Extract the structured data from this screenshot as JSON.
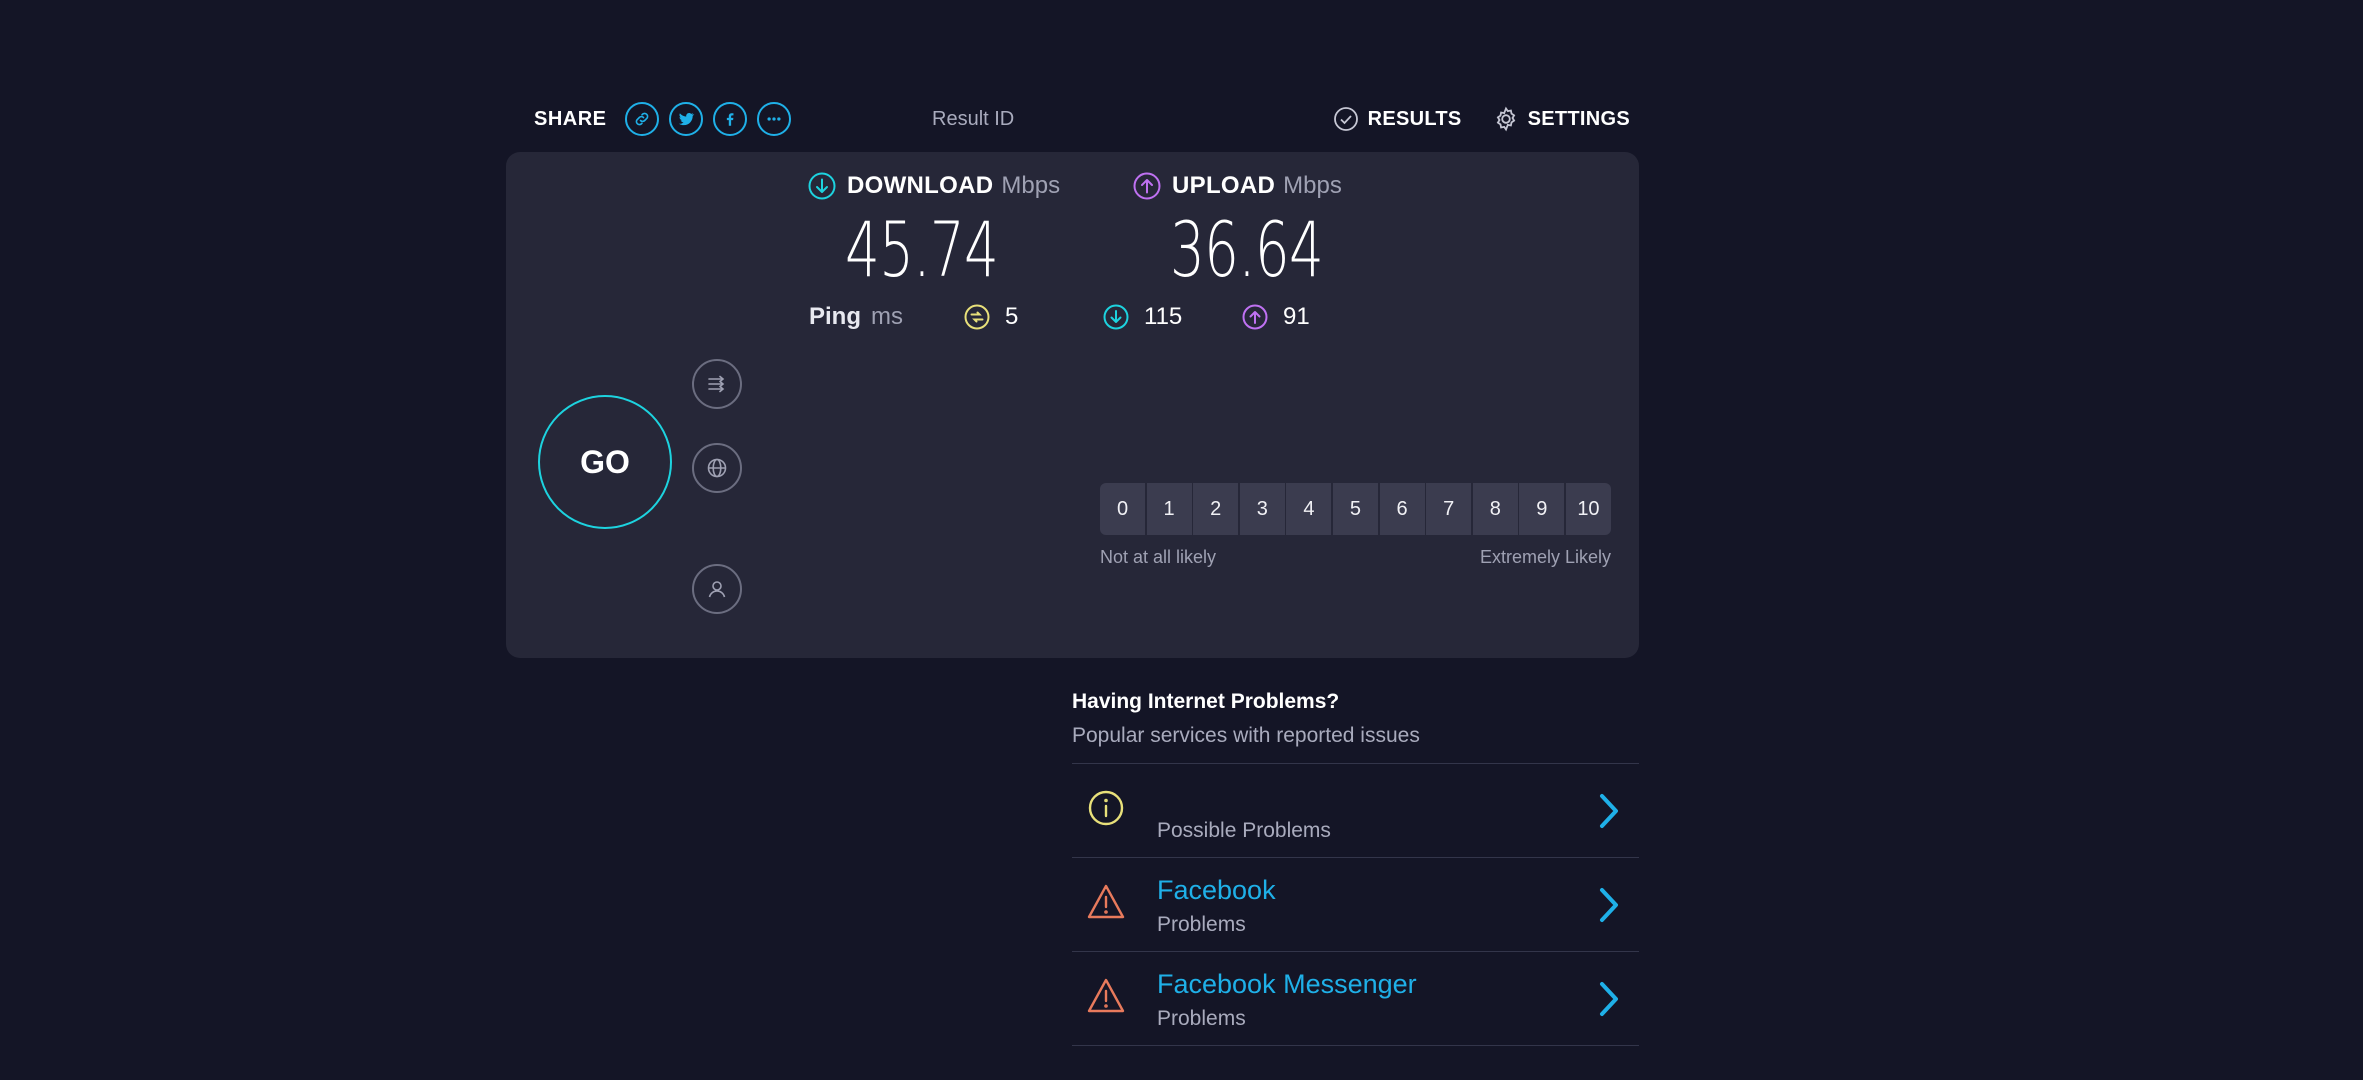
{
  "header": {
    "share_label": "SHARE",
    "share_buttons": [
      "link-icon",
      "twitter-icon",
      "facebook-icon",
      "more-icon"
    ],
    "result_id_label": "Result ID",
    "results_label": "RESULTS",
    "settings_label": "SETTINGS"
  },
  "test": {
    "go_label": "GO",
    "download": {
      "label": "DOWNLOAD",
      "unit": "Mbps",
      "value": "45.74",
      "color": "#1dd3df"
    },
    "upload": {
      "label": "UPLOAD",
      "unit": "Mbps",
      "value": "36.64",
      "color": "#bf71f2"
    },
    "ping": {
      "label": "Ping",
      "unit": "ms",
      "idle": "5",
      "download": "115",
      "upload": "91"
    }
  },
  "rating": {
    "options": [
      "0",
      "1",
      "2",
      "3",
      "4",
      "5",
      "6",
      "7",
      "8",
      "9",
      "10"
    ],
    "low_label": "Not at all likely",
    "high_label": "Extremely Likely"
  },
  "problems": {
    "title": "Having Internet Problems?",
    "subtitle": "Popular services with reported issues",
    "items": [
      {
        "name": "",
        "status": "Possible Problems",
        "icon": "info-icon"
      },
      {
        "name": "Facebook",
        "status": "Problems",
        "icon": "warning-icon"
      },
      {
        "name": "Facebook Messenger",
        "status": "Problems",
        "icon": "warning-icon"
      }
    ]
  },
  "colors": {
    "background": "#141526",
    "panel": "#262738",
    "accent_blue": "#1fb0e8",
    "download_teal": "#1dd3df",
    "upload_purple": "#bf71f2",
    "ping_yellow": "#e8e07a",
    "warning_orange": "#e87a5c"
  }
}
